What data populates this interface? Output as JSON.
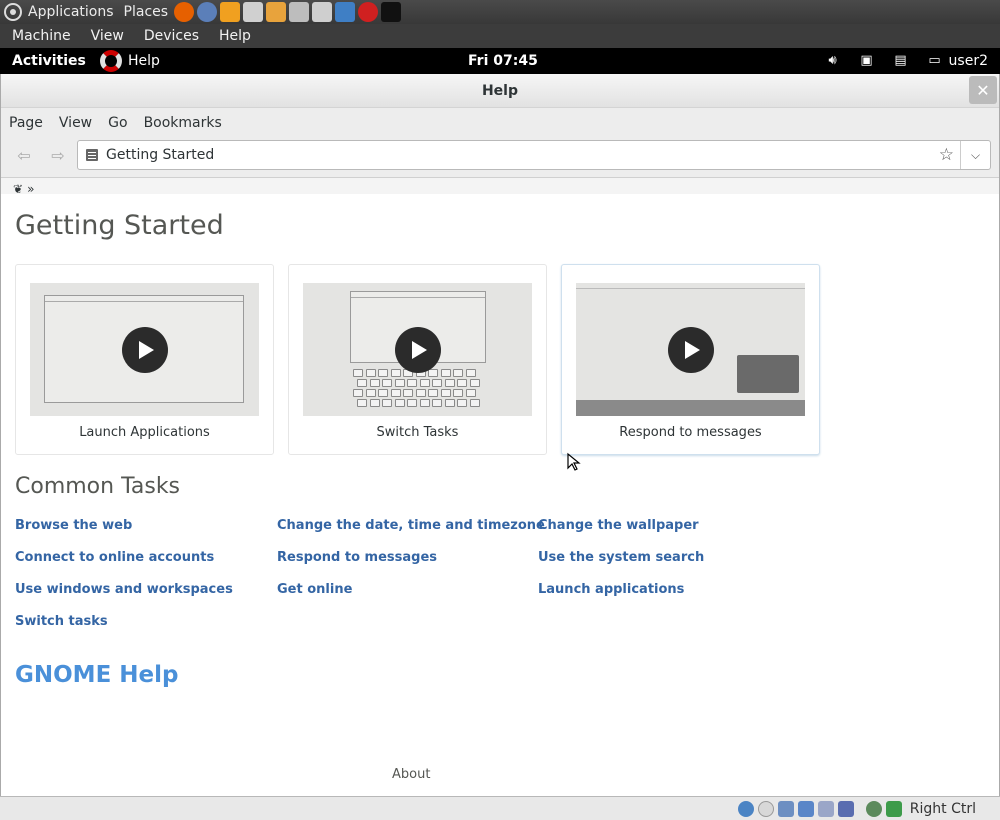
{
  "host_panel": {
    "menus": [
      "Applications",
      "Places"
    ],
    "launchers": [
      {
        "icon": "firefox-icon",
        "color": "#e66000"
      },
      {
        "icon": "thunderbird-icon",
        "color": "#5b7fb9"
      },
      {
        "icon": "cmdt-icon",
        "color": "#f0a020"
      },
      {
        "icon": "text-editor-icon",
        "color": "#d0d0d0"
      },
      {
        "icon": "folder-icon",
        "color": "#e8a33c"
      },
      {
        "icon": "scanner-icon",
        "color": "#bdbdbd"
      },
      {
        "icon": "camera-icon",
        "color": "#cfcfcf"
      },
      {
        "icon": "virtualbox-icon",
        "color": "#3f7fc5"
      },
      {
        "icon": "debian-icon",
        "color": "#d02020"
      },
      {
        "icon": "terminal-icon",
        "color": "#111111"
      }
    ]
  },
  "vm_menubar": {
    "items": [
      "Machine",
      "View",
      "Devices",
      "Help"
    ]
  },
  "shell_bar": {
    "activities": "Activities",
    "app_name": "Help",
    "clock": "Fri 07:45",
    "user": "user2"
  },
  "window": {
    "title": "Help",
    "menu": [
      "Page",
      "View",
      "Go",
      "Bookmarks"
    ],
    "location": "Getting Started",
    "breadcrumb": "»"
  },
  "page": {
    "title": "Getting Started",
    "cards": [
      {
        "label": "Launch Applications"
      },
      {
        "label": "Switch Tasks"
      },
      {
        "label": "Respond to messages"
      }
    ],
    "common_tasks_title": "Common Tasks",
    "tasks": [
      [
        "Browse the web",
        "Connect to online accounts",
        "Use windows and workspaces",
        "Switch tasks"
      ],
      [
        "Change the date, time and timezone",
        "Respond to messages",
        "Get online"
      ],
      [
        "Change the wallpaper",
        "Use the system search",
        "Launch applications"
      ]
    ],
    "gnome_help": "GNOME Help",
    "about": "About"
  },
  "statusbar": {
    "host_key": "Right Ctrl"
  }
}
